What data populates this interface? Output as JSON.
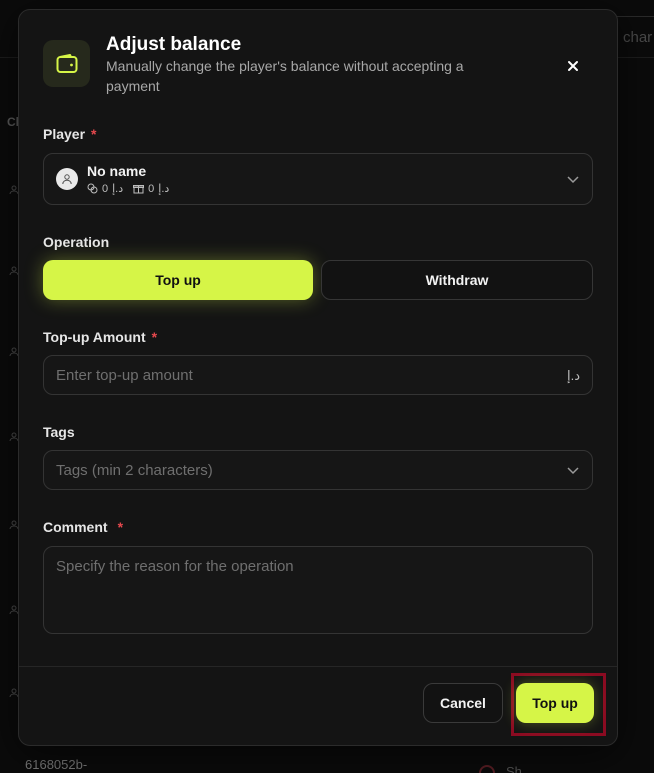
{
  "background": {
    "search_hint": "char",
    "column_head": "Cl",
    "row_id_partial": "6168052b-",
    "bottom_text": "Sh"
  },
  "modal": {
    "title": "Adjust balance",
    "subtitle": "Manually change the player's balance without accepting a payment",
    "header_icon": "wallet-icon",
    "close_icon": "close-icon"
  },
  "player": {
    "label": "Player",
    "required_mark": "*",
    "name": "No name",
    "balance_currency_1": "د.إ",
    "balance_value_1": "0",
    "balance_currency_2": "د.إ",
    "balance_value_2": "0"
  },
  "operation": {
    "label": "Operation",
    "options": [
      "Top up",
      "Withdraw"
    ],
    "selected": "Top up"
  },
  "amount": {
    "label": "Top-up Amount",
    "required_mark": "*",
    "placeholder": "Enter top-up amount",
    "currency": "د.إ"
  },
  "tags": {
    "label": "Tags",
    "placeholder": "Tags (min 2 characters)"
  },
  "comment": {
    "label": "Comment",
    "required_mark": "*",
    "placeholder": "Specify the reason for the operation"
  },
  "footer": {
    "cancel_label": "Cancel",
    "submit_label": "Top up"
  },
  "colors": {
    "accent": "#d6f547",
    "required": "#e5484d",
    "highlight_border": "#8b0b22"
  }
}
